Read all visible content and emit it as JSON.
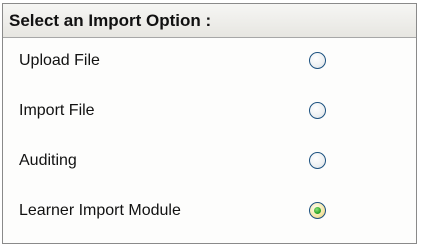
{
  "header": {
    "title": "Select an Import Option :"
  },
  "options": [
    {
      "label": "Upload File",
      "checked": false
    },
    {
      "label": "Import File",
      "checked": false
    },
    {
      "label": "Auditing",
      "checked": false
    },
    {
      "label": "Learner Import Module",
      "checked": true
    }
  ],
  "colors": {
    "radio_border": "#1d5280",
    "radio_selected_dot": "#2fa82a",
    "header_background": "#e7e6e1"
  }
}
